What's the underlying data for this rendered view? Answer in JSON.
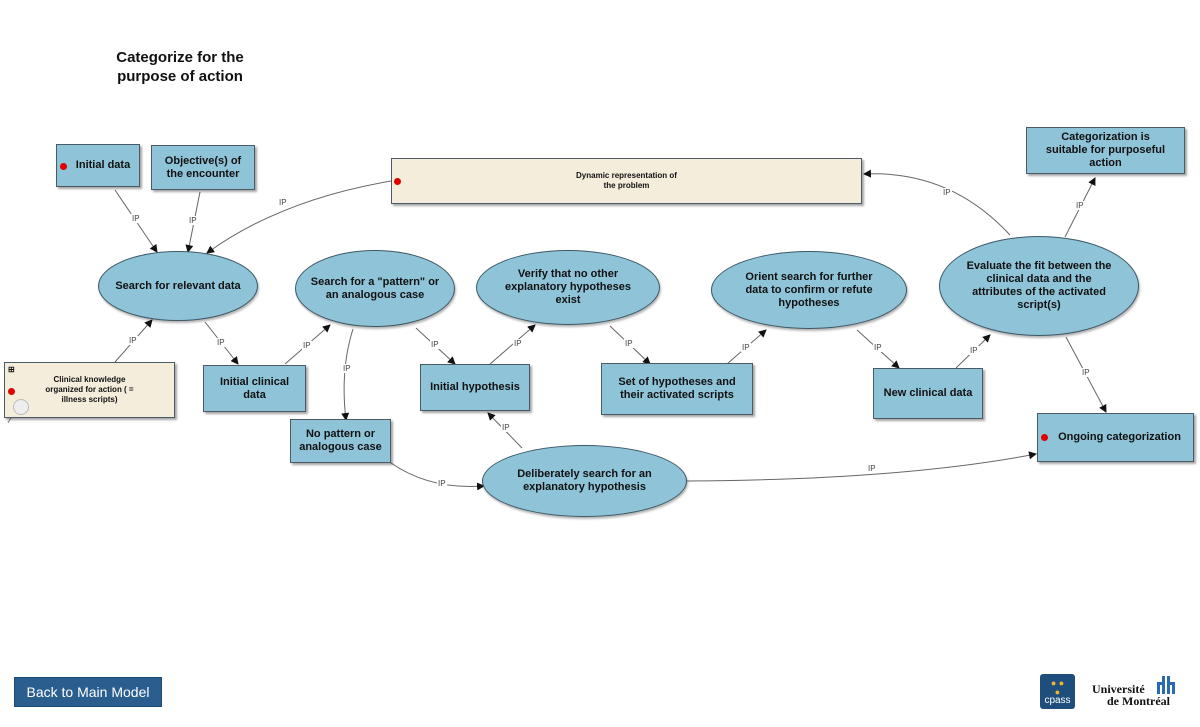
{
  "title": "Categorize for the purpose of action",
  "edge_label": "IP",
  "nodes": {
    "initial_data": "Initial data",
    "objectives": "Objective(s) of the encounter",
    "dynamic_representation": "Dynamic representation of the problem",
    "categorization_suitable": "Categorization is suitable for purposeful action",
    "search_relevant": "Search for relevant data",
    "search_pattern": "Search for a \"pattern\" or an analogous case",
    "verify_no_other": "Verify that no other explanatory hypotheses exist",
    "orient_search": "Orient search for further data to confirm or refute hypotheses",
    "evaluate_fit": "Evaluate the fit between the clinical data and the attributes of the activated script(s)",
    "clinical_knowledge": "Clinical knowledge organized for action ( = illness scripts)",
    "initial_clinical_data": "Initial clinical data",
    "initial_hypothesis": "Initial hypothesis",
    "set_hypotheses": "Set of hypotheses and their activated scripts",
    "new_clinical_data": "New clinical data",
    "ongoing_categorization": "Ongoing categorization",
    "no_pattern": "No pattern or analogous case",
    "deliberately_search": "Deliberately search for an explanatory hypothesis"
  },
  "footer": {
    "back_button": "Back to Main Model",
    "cpass_logo": "cpass",
    "university_line1": "Université",
    "university_line2": "de Montréal"
  },
  "colors": {
    "node_fill": "#8fc4d8",
    "note_fill": "#f5eddc",
    "marker": "#e00000",
    "button": "#2a5e8e"
  }
}
